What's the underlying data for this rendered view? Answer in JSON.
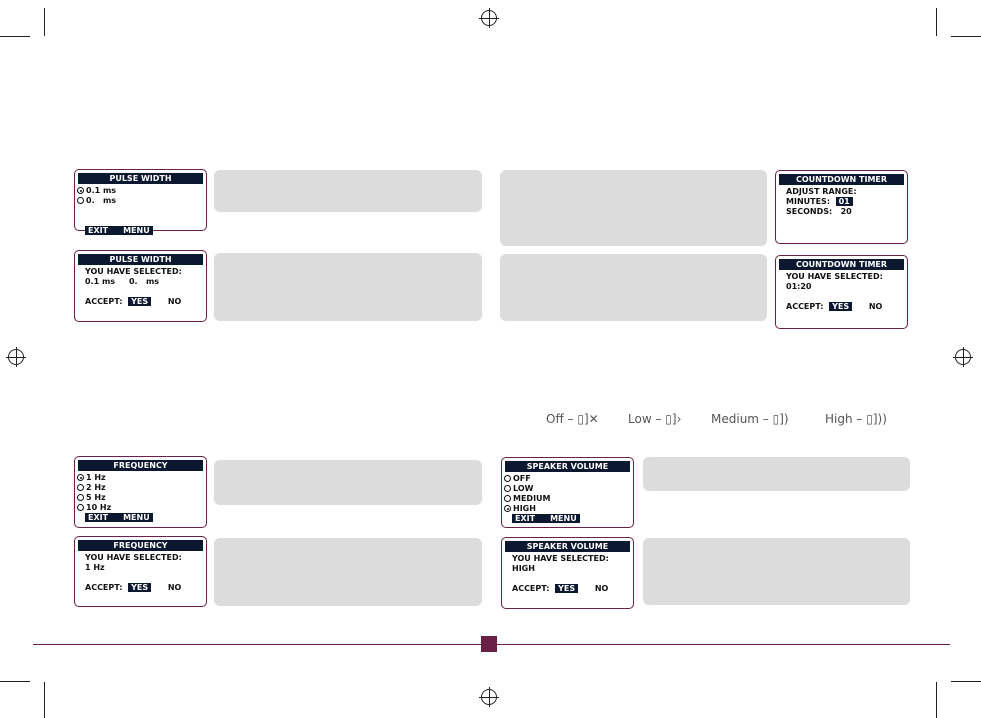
{
  "screens": [
    {
      "id": "pulse-width-select",
      "title": "PULSE WIDTH",
      "lines": [
        {
          "type": "opt",
          "selected": true,
          "text": "0.1 ms"
        },
        {
          "type": "opt",
          "selected": false,
          "text": "0.   ms"
        },
        {
          "type": "gap"
        },
        {
          "type": "gap"
        },
        {
          "type": "bar",
          "a": "EXIT",
          "b": "MENU"
        }
      ]
    },
    {
      "id": "pulse-width-confirm",
      "title": "PULSE WIDTH",
      "lines": [
        {
          "type": "text",
          "text": "YOU HAVE SELECTED:"
        },
        {
          "type": "text",
          "text": "0.1 ms     0.   ms"
        },
        {
          "type": "gap"
        },
        {
          "type": "accept",
          "label": "ACCEPT:",
          "yes": "YES",
          "no": "NO"
        }
      ]
    },
    {
      "id": "countdown-timer-adjust",
      "title": "COUNTDOWN TIMER",
      "lines": [
        {
          "type": "text",
          "text": "ADJUST RANGE:"
        },
        {
          "type": "field",
          "label": "MINUTES:  ",
          "value": "01",
          "hl": true
        },
        {
          "type": "field",
          "label": "SECONDS:   ",
          "value": "20",
          "hl": false
        }
      ]
    },
    {
      "id": "countdown-timer-confirm",
      "title": "COUNTDOWN TIMER",
      "lines": [
        {
          "type": "text",
          "text": "YOU HAVE SELECTED:"
        },
        {
          "type": "text",
          "text": "01:20"
        },
        {
          "type": "gap"
        },
        {
          "type": "accept",
          "label": "ACCEPT:",
          "yes": "YES",
          "no": "NO"
        }
      ]
    },
    {
      "id": "frequency-select",
      "title": "FREQUENCY",
      "lines": [
        {
          "type": "opt",
          "selected": true,
          "text": "1 Hz"
        },
        {
          "type": "opt",
          "selected": false,
          "text": "2 Hz"
        },
        {
          "type": "opt",
          "selected": false,
          "text": "5 Hz"
        },
        {
          "type": "opt",
          "selected": false,
          "text": "10 Hz"
        },
        {
          "type": "bar",
          "a": "EXIT",
          "b": "MENU"
        }
      ]
    },
    {
      "id": "frequency-confirm",
      "title": "FREQUENCY",
      "lines": [
        {
          "type": "text",
          "text": "YOU HAVE SELECTED:"
        },
        {
          "type": "text",
          "text": "1 Hz"
        },
        {
          "type": "gap"
        },
        {
          "type": "accept",
          "label": "ACCEPT:",
          "yes": "YES",
          "no": "NO"
        }
      ]
    },
    {
      "id": "speaker-volume-select",
      "title": "SPEAKER VOLUME",
      "lines": [
        {
          "type": "opt",
          "selected": false,
          "text": "OFF"
        },
        {
          "type": "opt",
          "selected": false,
          "text": "LOW"
        },
        {
          "type": "opt",
          "selected": false,
          "text": "MEDIUM"
        },
        {
          "type": "opt",
          "selected": true,
          "text": "HIGH"
        },
        {
          "type": "bar",
          "a": "EXIT",
          "b": "MENU"
        }
      ]
    },
    {
      "id": "speaker-volume-confirm",
      "title": "SPEAKER VOLUME",
      "lines": [
        {
          "type": "text",
          "text": "YOU HAVE SELECTED:"
        },
        {
          "type": "text",
          "text": "HIGH"
        },
        {
          "type": "gap"
        },
        {
          "type": "accept",
          "label": "ACCEPT:",
          "yes": "YES",
          "no": "NO"
        }
      ]
    }
  ],
  "volume_legend": [
    {
      "label": "Off –",
      "icon": "speaker-muted-icon",
      "glyph": "🕨✕"
    },
    {
      "label": "Low –",
      "icon": "speaker-low-icon",
      "glyph": "🕨"
    },
    {
      "label": "Medium –",
      "icon": "speaker-medium-icon",
      "glyph": "🕩"
    },
    {
      "label": "High –",
      "icon": "speaker-high-icon",
      "glyph": "🕪"
    }
  ],
  "colors": {
    "accent": "#6b2146",
    "lcd_header": "#0b1830",
    "panel": "#dcdcdc"
  }
}
